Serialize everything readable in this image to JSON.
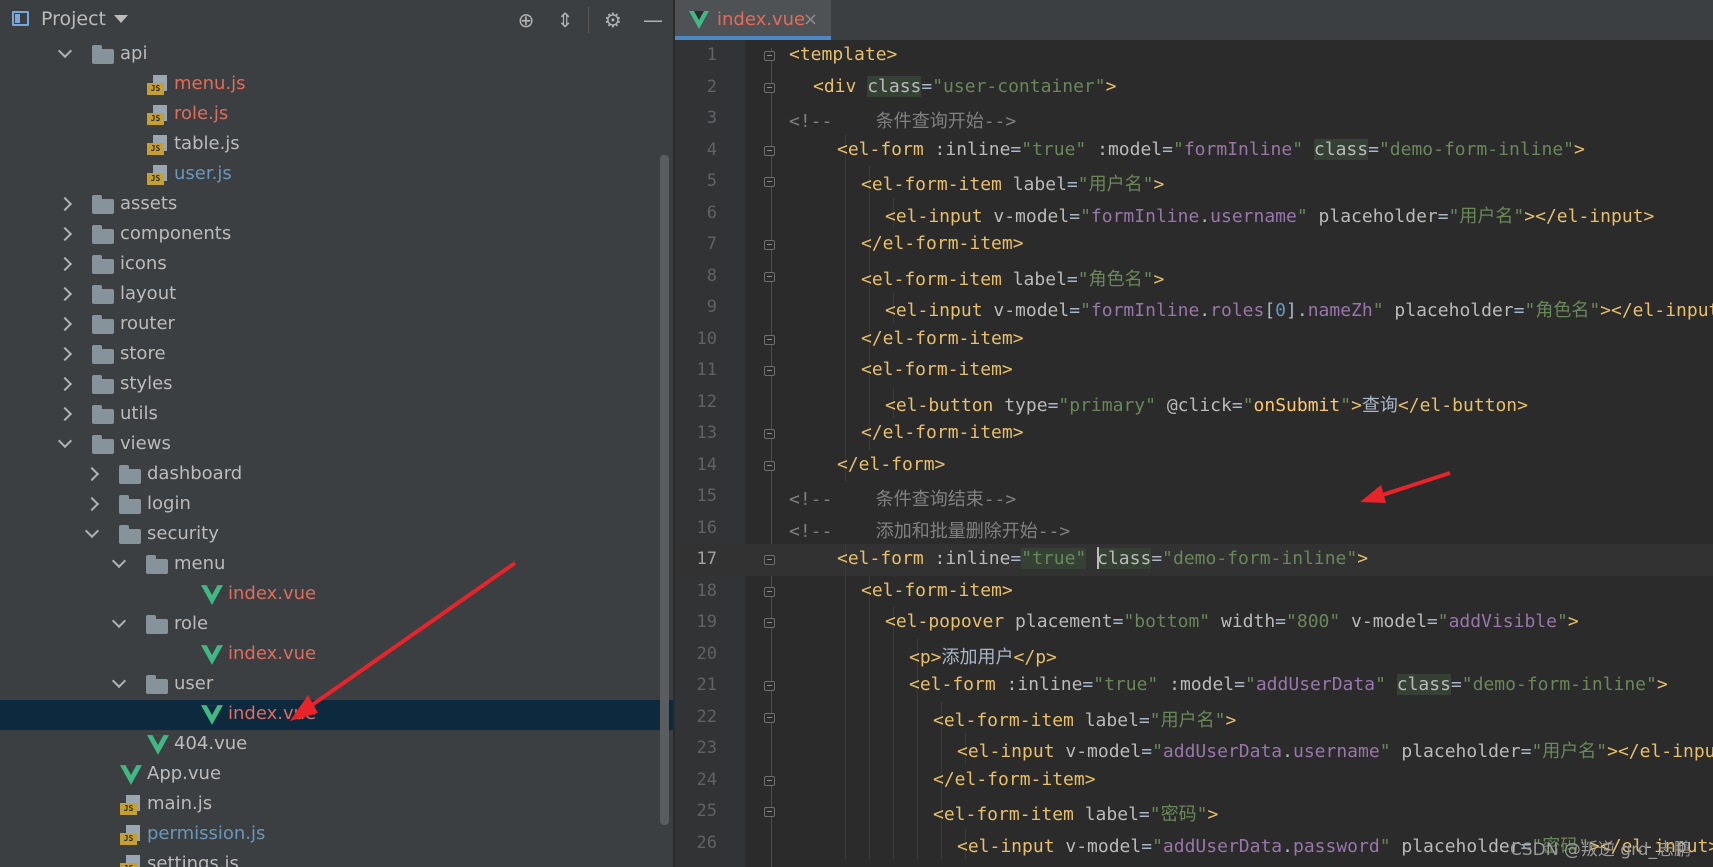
{
  "colors": {
    "panel_bg": "#3c3f41",
    "editor_bg": "#2b2b2b",
    "selection": "#0d293e",
    "vcs_modified": "#6897bb",
    "vcs_new": "#e06c5c",
    "tag": "#e8bf6a",
    "attr_value": "#6a8759",
    "bound_prop": "#9876aa",
    "comment": "#808080",
    "arrow": "#e8242a"
  },
  "project": {
    "title": "Project",
    "toolbar_icons": [
      "locate-icon",
      "collapse-all-icon",
      "settings-gear-icon",
      "hide-minimize-icon"
    ]
  },
  "tree": [
    {
      "label": "api",
      "type": "folder",
      "indent": 0,
      "expanded": true,
      "color": "default"
    },
    {
      "label": "menu.js",
      "type": "js",
      "indent": 1,
      "color": "red"
    },
    {
      "label": "role.js",
      "type": "js",
      "indent": 1,
      "color": "red"
    },
    {
      "label": "table.js",
      "type": "js",
      "indent": 1,
      "color": "default"
    },
    {
      "label": "user.js",
      "type": "js",
      "indent": 1,
      "color": "blue"
    },
    {
      "label": "assets",
      "type": "folder",
      "indent": 0,
      "expanded": false,
      "color": "default"
    },
    {
      "label": "components",
      "type": "folder",
      "indent": 0,
      "expanded": false,
      "color": "default"
    },
    {
      "label": "icons",
      "type": "folder",
      "indent": 0,
      "expanded": false,
      "color": "default"
    },
    {
      "label": "layout",
      "type": "folder",
      "indent": 0,
      "expanded": false,
      "color": "default"
    },
    {
      "label": "router",
      "type": "folder",
      "indent": 0,
      "expanded": false,
      "color": "default"
    },
    {
      "label": "store",
      "type": "folder",
      "indent": 0,
      "expanded": false,
      "color": "default"
    },
    {
      "label": "styles",
      "type": "folder",
      "indent": 0,
      "expanded": false,
      "color": "default"
    },
    {
      "label": "utils",
      "type": "folder",
      "indent": 0,
      "expanded": false,
      "color": "default"
    },
    {
      "label": "views",
      "type": "folder",
      "indent": 0,
      "expanded": true,
      "color": "default"
    },
    {
      "label": "dashboard",
      "type": "folder",
      "indent": 1,
      "expanded": false,
      "color": "default"
    },
    {
      "label": "login",
      "type": "folder",
      "indent": 1,
      "expanded": false,
      "color": "default"
    },
    {
      "label": "security",
      "type": "folder",
      "indent": 1,
      "expanded": true,
      "color": "default"
    },
    {
      "label": "menu",
      "type": "folder",
      "indent": 2,
      "expanded": true,
      "color": "default"
    },
    {
      "label": "index.vue",
      "type": "vue",
      "indent": 3,
      "color": "red"
    },
    {
      "label": "role",
      "type": "folder",
      "indent": 2,
      "expanded": true,
      "color": "default"
    },
    {
      "label": "index.vue",
      "type": "vue",
      "indent": 3,
      "color": "red"
    },
    {
      "label": "user",
      "type": "folder",
      "indent": 2,
      "expanded": true,
      "color": "default"
    },
    {
      "label": "index.vue",
      "type": "vue",
      "indent": 3,
      "color": "red",
      "selected": true
    },
    {
      "label": "404.vue",
      "type": "vue",
      "indent": 1,
      "color": "default"
    },
    {
      "label": "App.vue",
      "type": "vue",
      "indent": 0,
      "color": "default"
    },
    {
      "label": "main.js",
      "type": "js",
      "indent": 0,
      "color": "default"
    },
    {
      "label": "permission.js",
      "type": "js",
      "indent": 0,
      "color": "blue"
    },
    {
      "label": "settings.js",
      "type": "js",
      "indent": 0,
      "color": "default"
    }
  ],
  "editor": {
    "tab_label": "index.vue",
    "tab_close": "×",
    "current_line": 17,
    "lines": [
      {
        "n": "1",
        "indent": 0,
        "fold": true,
        "tokens": [
          [
            "<template>",
            "tag"
          ]
        ]
      },
      {
        "n": "2",
        "indent": 1,
        "fold": true,
        "tokens": [
          [
            "<div ",
            "tag"
          ],
          [
            "class",
            "attrHL"
          ],
          [
            "=",
            "plain"
          ],
          [
            "\"user-container\"",
            "val"
          ],
          [
            ">",
            "tag"
          ]
        ]
      },
      {
        "n": "3",
        "indent": 0,
        "fold": false,
        "tokens": [
          [
            "<!--    条件查询开始-->",
            "comment"
          ]
        ]
      },
      {
        "n": "4",
        "indent": 2,
        "fold": true,
        "tokens": [
          [
            "<el-form ",
            "tag"
          ],
          [
            ":inline",
            "attr"
          ],
          [
            "=",
            "plain"
          ],
          [
            "\"true\"",
            "val"
          ],
          [
            " ",
            "plain"
          ],
          [
            ":model",
            "attr"
          ],
          [
            "=",
            "plain"
          ],
          [
            "\"",
            "val"
          ],
          [
            "formInline",
            "prop"
          ],
          [
            "\" ",
            "val"
          ],
          [
            "class",
            "attrHL"
          ],
          [
            "=",
            "plain"
          ],
          [
            "\"demo-form-inline\"",
            "val"
          ],
          [
            ">",
            "tag"
          ]
        ]
      },
      {
        "n": "5",
        "indent": 3,
        "fold": true,
        "tokens": [
          [
            "<el-form-item ",
            "tag"
          ],
          [
            "label",
            "attr"
          ],
          [
            "=",
            "plain"
          ],
          [
            "\"用户名\"",
            "val"
          ],
          [
            ">",
            "tag"
          ]
        ]
      },
      {
        "n": "6",
        "indent": 4,
        "fold": false,
        "tokens": [
          [
            "<el-input ",
            "tag"
          ],
          [
            "v-model",
            "attr"
          ],
          [
            "=",
            "plain"
          ],
          [
            "\"",
            "val"
          ],
          [
            "formInline",
            "prop"
          ],
          [
            ".",
            "plain"
          ],
          [
            "username",
            "prop"
          ],
          [
            "\" ",
            "val"
          ],
          [
            "placeholder",
            "attr"
          ],
          [
            "=",
            "plain"
          ],
          [
            "\"用户名\"",
            "val"
          ],
          [
            "></el-input>",
            "tag"
          ]
        ]
      },
      {
        "n": "7",
        "indent": 3,
        "fold": true,
        "tokens": [
          [
            "</el-form-item>",
            "tag"
          ]
        ]
      },
      {
        "n": "8",
        "indent": 3,
        "fold": true,
        "tokens": [
          [
            "<el-form-item ",
            "tag"
          ],
          [
            "label",
            "attr"
          ],
          [
            "=",
            "plain"
          ],
          [
            "\"角色名\"",
            "val"
          ],
          [
            ">",
            "tag"
          ]
        ]
      },
      {
        "n": "9",
        "indent": 4,
        "fold": false,
        "tokens": [
          [
            "<el-input ",
            "tag"
          ],
          [
            "v-model",
            "attr"
          ],
          [
            "=",
            "plain"
          ],
          [
            "\"",
            "val"
          ],
          [
            "formInline",
            "prop"
          ],
          [
            ".",
            "plain"
          ],
          [
            "roles",
            "prop"
          ],
          [
            "[",
            "plain"
          ],
          [
            "0",
            "num"
          ],
          [
            "].",
            "plain"
          ],
          [
            "nameZh",
            "prop"
          ],
          [
            "\" ",
            "val"
          ],
          [
            "placeholder",
            "attr"
          ],
          [
            "=",
            "plain"
          ],
          [
            "\"角色名\"",
            "val"
          ],
          [
            "></el-input>",
            "tag"
          ]
        ]
      },
      {
        "n": "10",
        "indent": 3,
        "fold": true,
        "tokens": [
          [
            "</el-form-item>",
            "tag"
          ]
        ]
      },
      {
        "n": "11",
        "indent": 3,
        "fold": true,
        "tokens": [
          [
            "<el-form-item>",
            "tag"
          ]
        ]
      },
      {
        "n": "12",
        "indent": 4,
        "fold": false,
        "tokens": [
          [
            "<el-button ",
            "tag"
          ],
          [
            "type",
            "attr"
          ],
          [
            "=",
            "plain"
          ],
          [
            "\"primary\"",
            "val"
          ],
          [
            " ",
            "plain"
          ],
          [
            "@click",
            "attr"
          ],
          [
            "=",
            "plain"
          ],
          [
            "\"",
            "val"
          ],
          [
            "onSubmit",
            "fn"
          ],
          [
            "\"",
            "val"
          ],
          [
            ">",
            "tag"
          ],
          [
            "查询",
            "plain"
          ],
          [
            "</el-button>",
            "tag"
          ]
        ]
      },
      {
        "n": "13",
        "indent": 3,
        "fold": true,
        "tokens": [
          [
            "</el-form-item>",
            "tag"
          ]
        ]
      },
      {
        "n": "14",
        "indent": 2,
        "fold": true,
        "tokens": [
          [
            "</el-form>",
            "tag"
          ]
        ]
      },
      {
        "n": "15",
        "indent": 0,
        "fold": false,
        "tokens": [
          [
            "<!--    条件查询结束-->",
            "comment"
          ]
        ]
      },
      {
        "n": "16",
        "indent": 0,
        "fold": false,
        "tokens": [
          [
            "<!--    添加和批量删除开始-->",
            "comment"
          ]
        ]
      },
      {
        "n": "17",
        "indent": 2,
        "fold": true,
        "caret": true,
        "tokens": [
          [
            "<el-form ",
            "tag"
          ],
          [
            ":inline",
            "attr"
          ],
          [
            "=",
            "plain"
          ],
          [
            "\"true\"",
            "valHL"
          ],
          [
            " ",
            "plain"
          ],
          [
            "class",
            "attrHL"
          ],
          [
            "=",
            "plain"
          ],
          [
            "\"demo-form-inline\"",
            "val"
          ],
          [
            ">",
            "tag"
          ]
        ]
      },
      {
        "n": "18",
        "indent": 3,
        "fold": true,
        "tokens": [
          [
            "<el-form-item>",
            "tag"
          ]
        ]
      },
      {
        "n": "19",
        "indent": 4,
        "fold": true,
        "tokens": [
          [
            "<el-popover ",
            "tag"
          ],
          [
            "placement",
            "attr"
          ],
          [
            "=",
            "plain"
          ],
          [
            "\"bottom\"",
            "val"
          ],
          [
            " ",
            "plain"
          ],
          [
            "width",
            "attr"
          ],
          [
            "=",
            "plain"
          ],
          [
            "\"800\"",
            "val"
          ],
          [
            " ",
            "plain"
          ],
          [
            "v-model",
            "attr"
          ],
          [
            "=",
            "plain"
          ],
          [
            "\"",
            "val"
          ],
          [
            "addVisible",
            "prop"
          ],
          [
            "\"",
            "val"
          ],
          [
            ">",
            "tag"
          ]
        ]
      },
      {
        "n": "20",
        "indent": 5,
        "fold": false,
        "tokens": [
          [
            "<p>",
            "tag"
          ],
          [
            "添加用户",
            "plain"
          ],
          [
            "</p>",
            "tag"
          ]
        ]
      },
      {
        "n": "21",
        "indent": 5,
        "fold": true,
        "tokens": [
          [
            "<el-form ",
            "tag"
          ],
          [
            ":inline",
            "attr"
          ],
          [
            "=",
            "plain"
          ],
          [
            "\"true\"",
            "val"
          ],
          [
            " ",
            "plain"
          ],
          [
            ":model",
            "attr"
          ],
          [
            "=",
            "plain"
          ],
          [
            "\"",
            "val"
          ],
          [
            "addUserData",
            "prop"
          ],
          [
            "\" ",
            "val"
          ],
          [
            "class",
            "attrHL"
          ],
          [
            "=",
            "plain"
          ],
          [
            "\"demo-form-inline\"",
            "val"
          ],
          [
            ">",
            "tag"
          ]
        ]
      },
      {
        "n": "22",
        "indent": 6,
        "fold": true,
        "tokens": [
          [
            "<el-form-item ",
            "tag"
          ],
          [
            "label",
            "attr"
          ],
          [
            "=",
            "plain"
          ],
          [
            "\"用户名\"",
            "val"
          ],
          [
            ">",
            "tag"
          ]
        ]
      },
      {
        "n": "23",
        "indent": 7,
        "fold": false,
        "tokens": [
          [
            "<el-input ",
            "tag"
          ],
          [
            "v-model",
            "attr"
          ],
          [
            "=",
            "plain"
          ],
          [
            "\"",
            "val"
          ],
          [
            "addUserData",
            "prop"
          ],
          [
            ".",
            "plain"
          ],
          [
            "username",
            "prop"
          ],
          [
            "\" ",
            "val"
          ],
          [
            "placeholder",
            "attr"
          ],
          [
            "=",
            "plain"
          ],
          [
            "\"用户名\"",
            "val"
          ],
          [
            "></el-input>",
            "tag"
          ]
        ]
      },
      {
        "n": "24",
        "indent": 6,
        "fold": true,
        "tokens": [
          [
            "</el-form-item>",
            "tag"
          ]
        ]
      },
      {
        "n": "25",
        "indent": 6,
        "fold": true,
        "tokens": [
          [
            "<el-form-item ",
            "tag"
          ],
          [
            "label",
            "attr"
          ],
          [
            "=",
            "plain"
          ],
          [
            "\"密码\"",
            "val"
          ],
          [
            ">",
            "tag"
          ]
        ]
      },
      {
        "n": "26",
        "indent": 7,
        "fold": false,
        "tokens": [
          [
            "<el-input ",
            "tag"
          ],
          [
            "v-model",
            "attr"
          ],
          [
            "=",
            "plain"
          ],
          [
            "\"",
            "val"
          ],
          [
            "addUserData",
            "prop"
          ],
          [
            ".",
            "plain"
          ],
          [
            "password",
            "prop"
          ],
          [
            "\" ",
            "val"
          ],
          [
            "placeholder",
            "attr"
          ],
          [
            "=",
            "plain"
          ],
          [
            "\"密码\"",
            "val"
          ],
          [
            "></el-input>",
            "tag"
          ]
        ]
      }
    ]
  },
  "watermark": "CSDN @叛逆 grd_志鹏"
}
